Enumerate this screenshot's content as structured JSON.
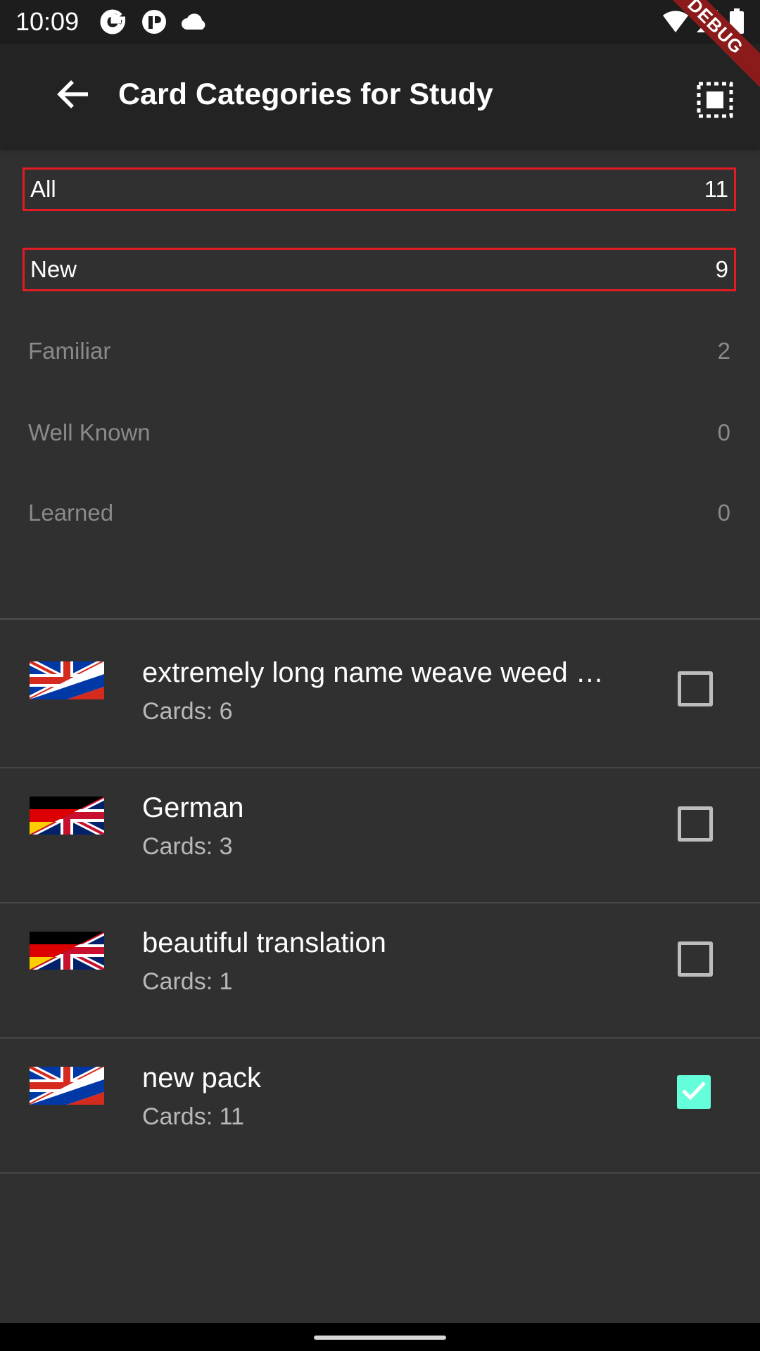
{
  "status_bar": {
    "time": "10:09",
    "debug_label": "DEBUG"
  },
  "app_bar": {
    "title": "Card Categories for Study"
  },
  "filters": [
    {
      "label": "All",
      "count": "11",
      "active": true
    },
    {
      "label": "New",
      "count": "9",
      "active": true
    },
    {
      "label": "Familiar",
      "count": "2",
      "active": false
    },
    {
      "label": "Well Known",
      "count": "0",
      "active": false
    },
    {
      "label": "Learned",
      "count": "0",
      "active": false
    }
  ],
  "packs": [
    {
      "name": "extremely long name weave weed …",
      "count": "Cards: 6",
      "flag": "en-ru",
      "checked": false
    },
    {
      "name": "German",
      "count": "Cards: 3",
      "flag": "de-en",
      "checked": false
    },
    {
      "name": "beautiful translation",
      "count": "Cards: 1",
      "flag": "de-en",
      "checked": false
    },
    {
      "name": "new pack",
      "count": "Cards: 11",
      "flag": "en-ru",
      "checked": true
    }
  ],
  "colors": {
    "accent": "#64ffda",
    "active_outline": "#e21b24",
    "background": "#303030",
    "app_bar": "#232323"
  },
  "icons": [
    "back-arrow-icon",
    "select-all-icon",
    "google-icon",
    "app-icon",
    "cloud-icon",
    "wifi-icon",
    "signal-icon",
    "battery-icon",
    "check-icon"
  ]
}
